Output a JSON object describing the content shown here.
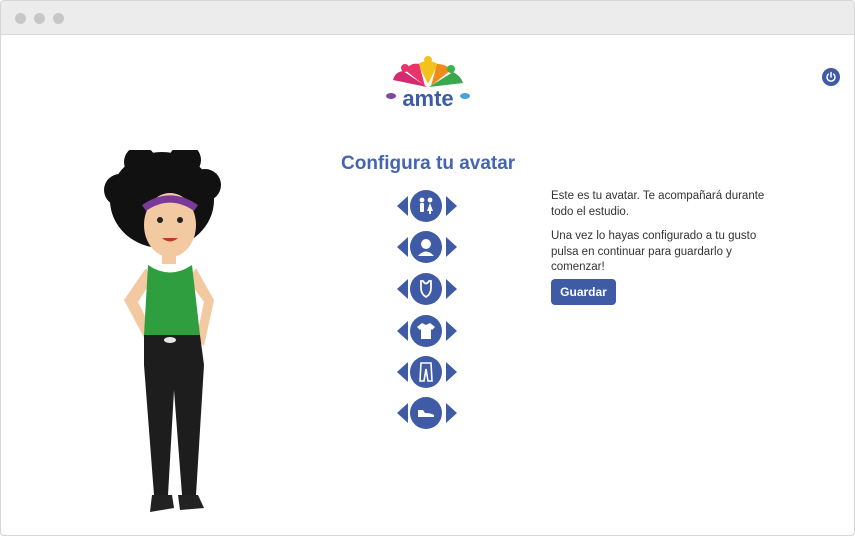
{
  "logo": {
    "text": "amte"
  },
  "heading": "Configura tu avatar",
  "selectors": [
    {
      "part": "gender",
      "icon": "gender-icon"
    },
    {
      "part": "face",
      "icon": "face-icon"
    },
    {
      "part": "top-underwear",
      "icon": "tank-top-icon"
    },
    {
      "part": "shirt",
      "icon": "shirt-icon"
    },
    {
      "part": "pants",
      "icon": "pants-icon"
    },
    {
      "part": "shoes",
      "icon": "shoe-icon"
    }
  ],
  "info": {
    "line1": "Este es tu avatar. Te acompañará durante todo el estudio.",
    "line2": "Una vez lo hayas configurado a tu gusto pulsa en continuar para guardarlo y comenzar!"
  },
  "save_label": "Guardar",
  "colors": {
    "primary": "#3f5ba6",
    "heading": "#4565b0"
  }
}
